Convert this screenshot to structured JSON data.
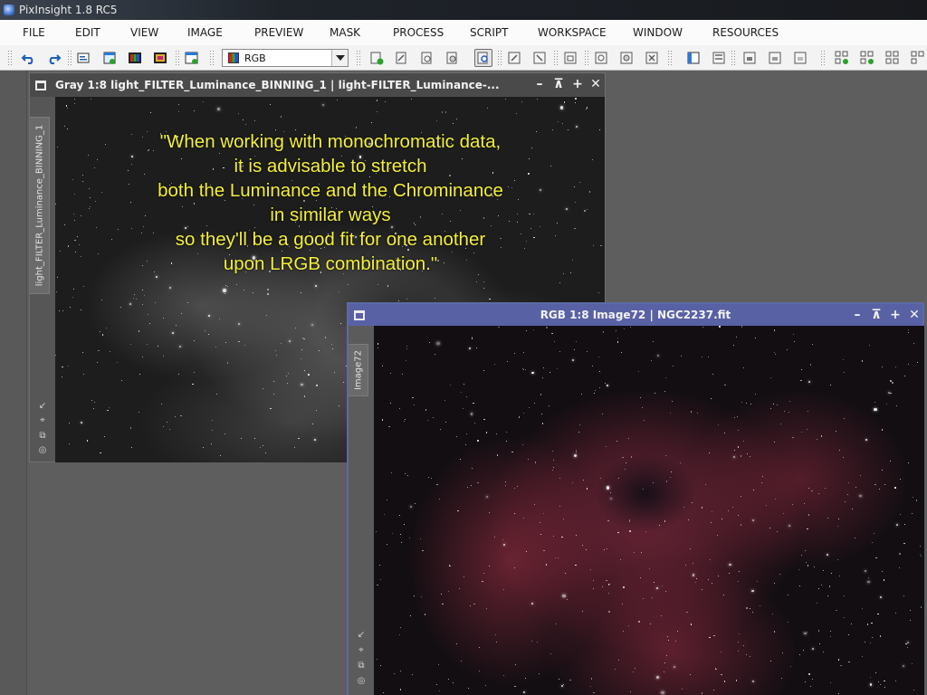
{
  "app": {
    "title": "PixInsight 1.8 RC5"
  },
  "menu": [
    "FILE",
    "EDIT",
    "VIEW",
    "IMAGE",
    "PREVIEW",
    "MASK",
    "PROCESS",
    "SCRIPT",
    "WORKSPACE",
    "WINDOW",
    "RESOURCES"
  ],
  "toolbar": {
    "rgb_select": "RGB",
    "icons": [
      "undo-icon",
      "redo-icon",
      "image-info-icon",
      "new-image-icon",
      "rgb-channels-icon",
      "channel-display-icon",
      "new-window-icon",
      "zoom-in-icon",
      "zoom-out-icon",
      "zoom-fit-icon",
      "zoom-actual-icon",
      "readout-mode-icon",
      "preview-mode-icon",
      "dynamic-pan-icon",
      "crop-icon",
      "zoom-mode-icon",
      "dynamic-crop-icon",
      "mask-show-icon",
      "mask-invert-icon",
      "mask-enable-icon",
      "explorer-icon",
      "history-icon",
      "format-explorer-icon",
      "view-explorer-icon",
      "process-explorer-icon",
      "script-editor-icon",
      "add-script-icon",
      "add-process-icon",
      "add-file-icon",
      "preferences-icon"
    ]
  },
  "gray_window": {
    "title": "Gray 1:8 light_FILTER_Luminance_BINNING_1 | light-FILTER_Luminance-...",
    "tab_label": "light_FILTER_Luminance_BINNING_1",
    "controls": [
      "–",
      "⊼",
      "+",
      "✕"
    ]
  },
  "rgb_window": {
    "title": "RGB 1:8 Image72 | NGC2237.fit",
    "tab_label": "Image72",
    "controls": [
      "–",
      "⊼",
      "+",
      "✕"
    ]
  },
  "caption": {
    "lines": [
      "\"When working with monochromatic data,",
      "it is advisable to stretch",
      "both the Luminance and the Chrominance",
      "in similar ways",
      "so they'll be a good fit for one another",
      "upon LRGB combination.\""
    ]
  },
  "colors": {
    "menu_bg": "#fbfbfb",
    "workspace_bg": "#5e5e5e",
    "active_window_title": "#5961a5",
    "caption_text": "#f3ef3a"
  }
}
